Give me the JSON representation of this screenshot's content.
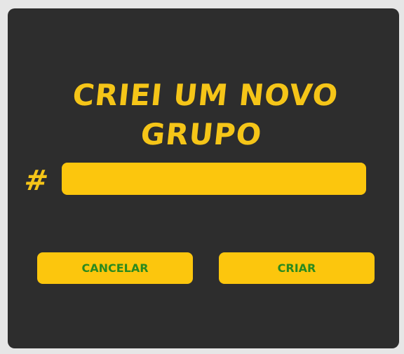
{
  "dialog": {
    "title_line1": "CRIEI UM NOVO",
    "title_line2": "GRUPO",
    "hash_symbol": "#",
    "group_name": {
      "value": "",
      "placeholder": ""
    },
    "cancel_label": "CANCELAR",
    "create_label": "CRIAR"
  },
  "colors": {
    "background": "#e6e6e6",
    "panel": "#2d2d2d",
    "accent_yellow": "#fcc60d",
    "button_text_green": "#2b8a1e"
  }
}
